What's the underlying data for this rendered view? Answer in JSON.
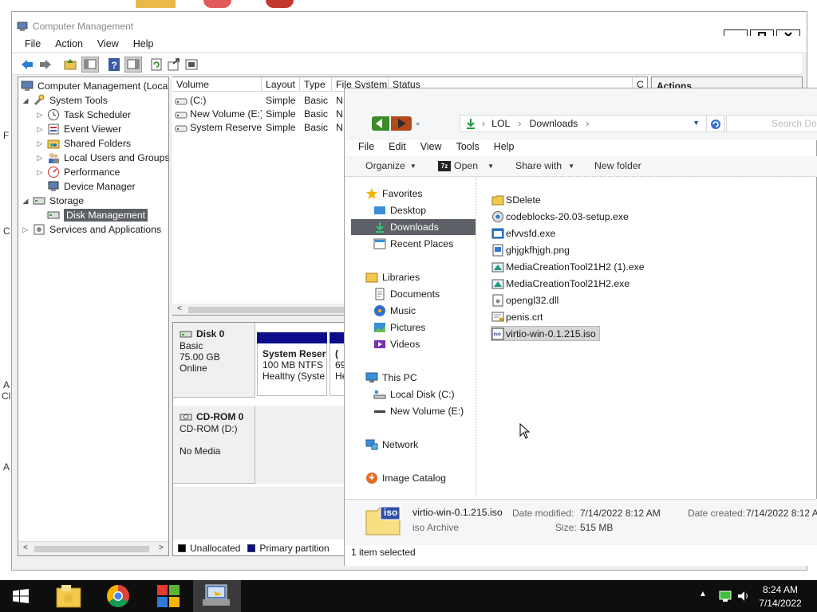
{
  "colors": {
    "selection": "#5d6066",
    "highlight_file": "#d6d6d6",
    "primary_partition": "#0d0d8a",
    "unallocated": "#000000",
    "taskbar": "#0e0e0e",
    "folder": "#f2c94c"
  },
  "desktop": {
    "edge_chars": [
      "F",
      "C",
      "A",
      "Cl",
      "A"
    ]
  },
  "computer_management": {
    "title": "Computer Management",
    "menu": [
      "File",
      "Action",
      "View",
      "Help"
    ],
    "toolbar_icons": [
      "back-icon",
      "forward-icon",
      "up-icon",
      "show-hide-tree-icon",
      "help-icon",
      "properties-icon",
      "refresh-icon",
      "export-list-icon",
      "settings-icon"
    ],
    "tree": [
      {
        "label": "Computer Management (Local",
        "icon": "computer-management-icon",
        "level": 0,
        "arrow": ""
      },
      {
        "label": "System Tools",
        "icon": "tools-icon",
        "level": 1,
        "arrow": "◢"
      },
      {
        "label": "Task Scheduler",
        "icon": "clock-icon",
        "level": 2,
        "arrow": "▷"
      },
      {
        "label": "Event Viewer",
        "icon": "event-viewer-icon",
        "level": 2,
        "arrow": "▷"
      },
      {
        "label": "Shared Folders",
        "icon": "shared-folder-icon",
        "level": 2,
        "arrow": "▷"
      },
      {
        "label": "Local Users and Groups",
        "icon": "users-icon",
        "level": 2,
        "arrow": "▷"
      },
      {
        "label": "Performance",
        "icon": "performance-icon",
        "level": 2,
        "arrow": "▷"
      },
      {
        "label": "Device Manager",
        "icon": "device-manager-icon",
        "level": 2,
        "arrow": ""
      },
      {
        "label": "Storage",
        "icon": "storage-icon",
        "level": 1,
        "arrow": "◢"
      },
      {
        "label": "Disk Management",
        "icon": "disk-icon",
        "level": 2,
        "arrow": "",
        "selected": true
      },
      {
        "label": "Services and Applications",
        "icon": "services-icon",
        "level": 1,
        "arrow": "▷"
      }
    ],
    "volume_headers": [
      "Volume",
      "Layout",
      "Type",
      "File System",
      "Status",
      "C"
    ],
    "volumes": [
      {
        "volume": "(C:)",
        "layout": "Simple",
        "type": "Basic",
        "fs": "N"
      },
      {
        "volume": "New Volume (E:)",
        "layout": "Simple",
        "type": "Basic",
        "fs": "N"
      },
      {
        "volume": "System Reserved",
        "layout": "Simple",
        "type": "Basic",
        "fs": "N"
      }
    ],
    "actions_header": "Actions",
    "disks": [
      {
        "name": "Disk 0",
        "line1": "Basic",
        "line2": "75.00 GB",
        "line3": "Online"
      },
      {
        "name": "CD-ROM 0",
        "line1": "CD-ROM (D:)",
        "line2": "",
        "line3": "No Media"
      }
    ],
    "partitions": [
      {
        "name": "System Reser",
        "size": "100 MB NTFS",
        "status": "Healthy (Syste"
      },
      {
        "name": "(",
        "size": "69",
        "status": "He"
      }
    ],
    "legend": [
      {
        "label": "Unallocated",
        "color": "#000000"
      },
      {
        "label": "Primary partition",
        "color": "#0d0d8a"
      }
    ]
  },
  "explorer": {
    "breadcrumb": [
      "LOL",
      "Downloads"
    ],
    "search_placeholder": "Search Do",
    "menu": [
      "File",
      "Edit",
      "View",
      "Tools",
      "Help"
    ],
    "commands": {
      "organize": "Organize",
      "open": "Open",
      "share_with": "Share with",
      "new_folder": "New folder"
    },
    "sidebar": {
      "favorites": {
        "label": "Favorites",
        "items": [
          "Desktop",
          "Downloads",
          "Recent Places"
        ]
      },
      "libraries": {
        "label": "Libraries",
        "items": [
          "Documents",
          "Music",
          "Pictures",
          "Videos"
        ]
      },
      "this_pc": {
        "label": "This PC",
        "items": [
          "Local Disk (C:)",
          "New Volume (E:)"
        ]
      },
      "network": "Network",
      "image_catalog": "Image Catalog"
    },
    "files": [
      {
        "name": "SDelete",
        "icon": "folder-icon"
      },
      {
        "name": "codeblocks-20.03-setup.exe",
        "icon": "installer-icon"
      },
      {
        "name": "efvvsfd.exe",
        "icon": "exe-icon"
      },
      {
        "name": "ghjgkfhjgh.png",
        "icon": "image-file-icon"
      },
      {
        "name": "MediaCreationTool21H2 (1).exe",
        "icon": "media-creation-icon"
      },
      {
        "name": "MediaCreationTool21H2.exe",
        "icon": "media-creation-icon"
      },
      {
        "name": "opengl32.dll",
        "icon": "dll-icon"
      },
      {
        "name": "penis.crt",
        "icon": "certificate-icon"
      },
      {
        "name": "virtio-win-0.1.215.iso",
        "icon": "iso-icon",
        "selected": true
      }
    ],
    "details": {
      "name": "virtio-win-0.1.215.iso",
      "type": "iso Archive",
      "modified_label": "Date modified:",
      "modified": "7/14/2022 8:12 AM",
      "size_label": "Size:",
      "size": "515 MB",
      "created_label": "Date created:",
      "created": "7/14/2022 8:12 A",
      "iso_tag": "iso"
    },
    "status": "1 item selected"
  },
  "taskbar": {
    "apps": [
      "start-icon",
      "file-explorer-icon",
      "chrome-icon",
      "store-icon",
      "computer-management-icon"
    ],
    "time": "8:24 AM",
    "date": "7/14/2022"
  }
}
